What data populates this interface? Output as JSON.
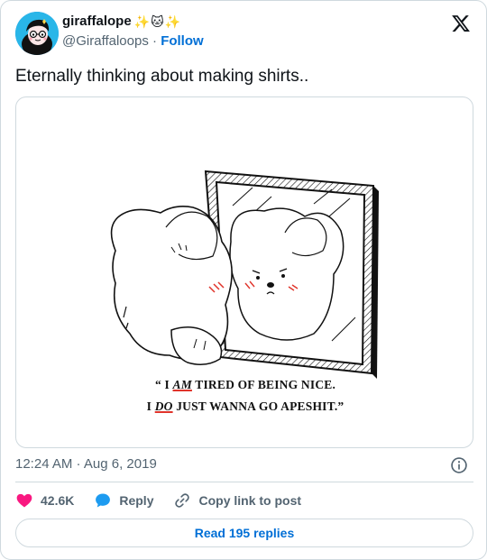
{
  "author": {
    "display_name": "giraffalope",
    "emoji_suffix": "✨🐱✨",
    "handle": "@Giraffaloops",
    "separator": "·",
    "follow_label": "Follow"
  },
  "tweet": {
    "text": "Eternally thinking about making shirts..",
    "image": {
      "quote_line1_open": "“ I",
      "quote_line1_em": "AM",
      "quote_line1_rest": "TIRED OF BEING NICE.",
      "quote_line2_start": "I",
      "quote_line2_em": "DO",
      "quote_line2_rest": "JUST WANNA GO APESHIT.”"
    },
    "timestamp": "12:24 AM · Aug 6, 2019"
  },
  "actions": {
    "like_count": "42.6K",
    "reply_label": "Reply",
    "copy_label": "Copy link to post"
  },
  "read_replies_label": "Read 195 replies",
  "colors": {
    "like": "#f91880",
    "reply": "#1d9bf0",
    "link": "#006fd6",
    "secondary_text": "#536471",
    "border": "#cfd9de"
  },
  "icons": {
    "brand": "x-logo-icon",
    "info": "info-icon",
    "like": "heart-icon",
    "reply": "speech-bubble-icon",
    "copy": "link-icon"
  }
}
